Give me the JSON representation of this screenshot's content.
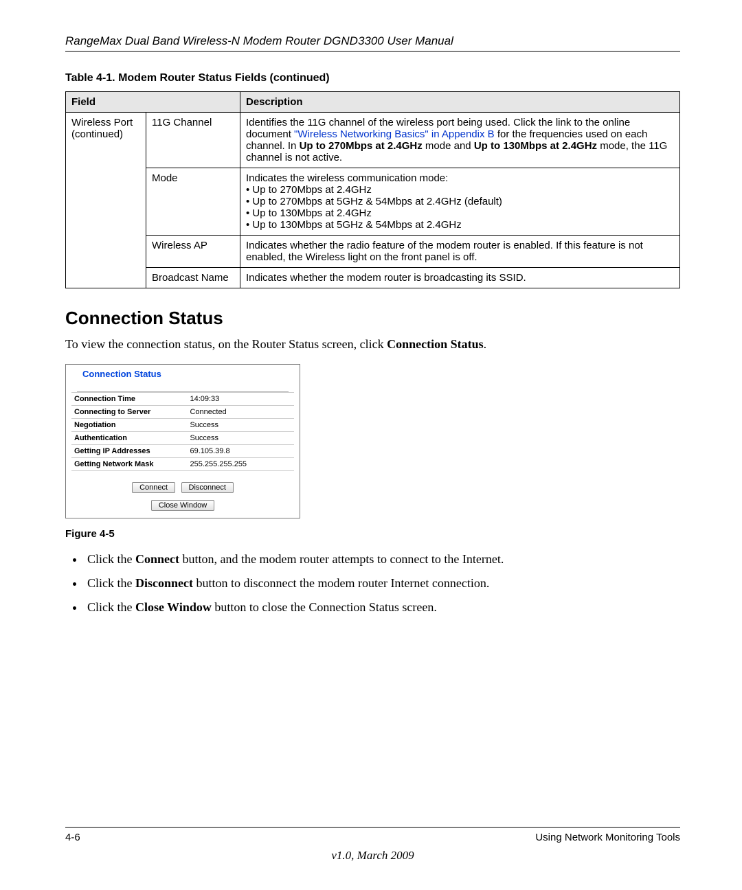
{
  "header": {
    "title": "RangeMax Dual Band Wireless-N Modem Router DGND3300 User Manual"
  },
  "table": {
    "caption": "Table 4-1.  Modem Router Status Fields (continued)",
    "head": {
      "field": "Field",
      "description": "Description"
    },
    "groupLabel": "Wireless Port (continued)",
    "rows": [
      {
        "field": "11G Channel",
        "desc_pre": "Identifies the 11G channel of the wireless port being used. Click the link to the online document ",
        "desc_link": "\"Wireless Networking Basics\" in Appendix B",
        "desc_mid": " for the frequencies used on each channel. In ",
        "desc_b1": "Up to 270Mbps at 2.4GHz",
        "desc_mid2": " mode and ",
        "desc_b2": "Up to 130Mbps at 2.4GHz",
        "desc_post": " mode, the 11G channel is not active."
      },
      {
        "field": "Mode",
        "desc_line": "Indicates the wireless communication mode:",
        "desc_items": [
          "Up to 270Mbps at 2.4GHz",
          "Up to 270Mbps at 5GHz & 54Mbps at 2.4GHz (default)",
          "Up to 130Mbps at 2.4GHz",
          "Up to 130Mbps at 5GHz & 54Mbps at 2.4GHz"
        ]
      },
      {
        "field": "Wireless AP",
        "desc": "Indicates whether the radio feature of the modem router is enabled. If this feature is not enabled, the Wireless light on the front panel is off."
      },
      {
        "field": "Broadcast Name",
        "desc": "Indicates whether the modem router is broadcasting its SSID."
      }
    ]
  },
  "section": {
    "heading": "Connection Status",
    "intro_pre": "To view the connection status, on the Router Status screen, click ",
    "intro_bold": "Connection Status",
    "intro_post": "."
  },
  "cs": {
    "title": "Connection Status",
    "rows": [
      {
        "label": "Connection Time",
        "value": "14:09:33"
      },
      {
        "label": "Connecting to Server",
        "value": "Connected"
      },
      {
        "label": "Negotiation",
        "value": "Success"
      },
      {
        "label": "Authentication",
        "value": "Success"
      },
      {
        "label": "Getting IP Addresses",
        "value": "69.105.39.8"
      },
      {
        "label": "Getting Network Mask",
        "value": "255.255.255.255"
      }
    ],
    "buttons": {
      "connect": "Connect",
      "disconnect": "Disconnect",
      "close": "Close Window"
    }
  },
  "figureCaption": "Figure 4-5",
  "bullets": [
    {
      "pre": "Click the ",
      "bold": "Connect",
      "post": " button, and the modem router attempts to connect to the Internet."
    },
    {
      "pre": "Click the ",
      "bold": "Disconnect",
      "post": " button to disconnect the modem router Internet connection."
    },
    {
      "pre": "Click the ",
      "bold": "Close Window",
      "post": " button to close the Connection Status screen."
    }
  ],
  "footer": {
    "left": "4-6",
    "right": "Using Network Monitoring Tools",
    "version": "v1.0, March 2009"
  }
}
